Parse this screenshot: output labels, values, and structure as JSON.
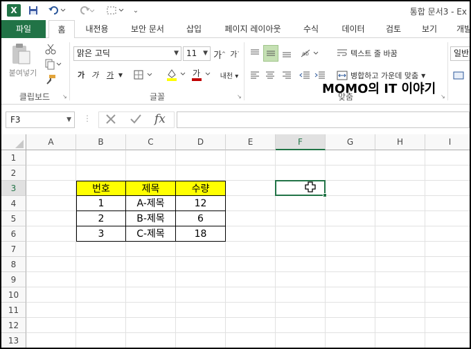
{
  "app": {
    "logo_glyph": "X",
    "title": "통합 문서3 - Ex"
  },
  "quick_access": {
    "save": "💾",
    "undo": "↶",
    "redo": "↷",
    "more": "⌄"
  },
  "tabs": [
    {
      "label": "파일"
    },
    {
      "label": "홈"
    },
    {
      "label": "내전용"
    },
    {
      "label": "보안 문서"
    },
    {
      "label": "삽입"
    },
    {
      "label": "페이지 레이아웃"
    },
    {
      "label": "수식"
    },
    {
      "label": "데이터"
    },
    {
      "label": "검토"
    },
    {
      "label": "보기"
    },
    {
      "label": "개발"
    }
  ],
  "ribbon": {
    "clipboard": {
      "paste_label": "붙여넣기",
      "group_label": "클립보드"
    },
    "font": {
      "font_name": "맑은 고딕",
      "font_size": "11",
      "bold": "가",
      "italic": "가",
      "underline": "가",
      "group_label": "글꼴"
    },
    "alignment": {
      "wrap_text": "텍스트 줄 바꿈",
      "merge_center": "병합하고 가운데 맞춤",
      "group_label": "맞춤"
    },
    "number": {
      "format": "일반"
    }
  },
  "watermark": "MOMO의 IT 이야기",
  "formula_bar": {
    "name_box": "F3",
    "fx": "fx",
    "formula": ""
  },
  "sheet": {
    "columns": [
      "A",
      "B",
      "C",
      "D",
      "E",
      "F",
      "G",
      "H",
      "I"
    ],
    "rows": [
      "1",
      "2",
      "3",
      "4",
      "5",
      "6",
      "7",
      "8",
      "9",
      "10",
      "11",
      "12",
      "13"
    ],
    "selected_column": "F",
    "selected_row": "3",
    "table": {
      "headers": [
        "번호",
        "제목",
        "수량"
      ],
      "rows": [
        [
          "1",
          "A-제목",
          "12"
        ],
        [
          "2",
          "B-제목",
          "6"
        ],
        [
          "3",
          "C-제목",
          "18"
        ]
      ],
      "header_color": "#ffff00"
    }
  },
  "colors": {
    "excel_green": "#217346"
  }
}
